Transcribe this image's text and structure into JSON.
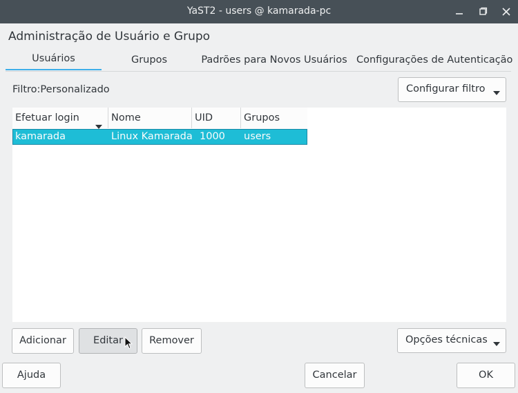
{
  "window": {
    "title": "YaST2 - users @ kamarada-pc",
    "controls": [
      "minimize-icon",
      "maximize-icon",
      "close-icon"
    ]
  },
  "heading": "Administração de Usuário e Grupo",
  "tabs": [
    {
      "label": "Usuários",
      "active": true
    },
    {
      "label": "Grupos",
      "active": false
    },
    {
      "label": "Padrões para Novos Usuários",
      "active": false
    },
    {
      "label": "Configurações de Autenticação",
      "active": false
    }
  ],
  "filter": {
    "label": "Filtro:Personalizado",
    "configure_label": "Configurar filtro"
  },
  "table": {
    "columns": [
      "Efetuar login",
      "Nome",
      "UID",
      "Grupos"
    ],
    "rows": [
      {
        "login": "kamarada",
        "name": "Linux Kamarada",
        "uid": "1000",
        "groups": "users",
        "selected": true
      }
    ]
  },
  "actions": {
    "add": "Adicionar",
    "edit": "Editar",
    "remove": "Remover",
    "technical_options": "Opções técnicas"
  },
  "footer": {
    "help": "Ajuda",
    "cancel": "Cancelar",
    "ok": "OK"
  },
  "colors": {
    "titlebar": "#475057",
    "selection": "#1ebdd6",
    "tab_accent": "#3daee9"
  }
}
